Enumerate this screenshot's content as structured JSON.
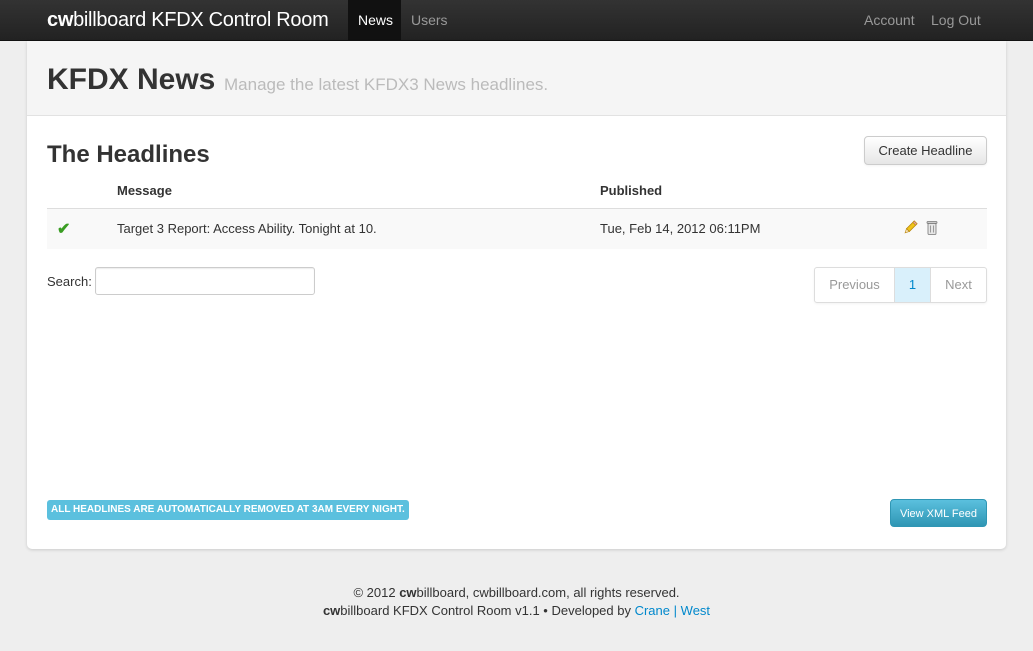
{
  "navbar": {
    "brand_bold": "cw",
    "brand_rest": "billboard KFDX Control Room",
    "items": [
      {
        "label": "News",
        "active": true
      },
      {
        "label": "Users",
        "active": false
      }
    ],
    "account_label": "Account",
    "logout_label": "Log Out"
  },
  "hero": {
    "title": "KFDX News",
    "subtitle": "Manage the latest KFDX3 News headlines."
  },
  "headlines": {
    "title": "The Headlines",
    "create_button": "Create Headline",
    "columns": [
      "Message",
      "Published"
    ],
    "rows": [
      {
        "status_icon": "check-icon",
        "message": "Target 3 Report: Access Ability. Tonight at 10.",
        "published": "Tue, Feb 14, 2012 06:11PM",
        "actions": [
          "edit-pencil-icon",
          "delete-trash-icon"
        ]
      }
    ]
  },
  "search": {
    "label": "Search:",
    "value": "",
    "placeholder": ""
  },
  "pagination": {
    "previous": "Previous",
    "current": "1",
    "next": "Next"
  },
  "notice": "All headlines are automatically removed at 3am every night.",
  "xml_button": "View XML Feed",
  "footer": {
    "line1_prefix": "© 2012 ",
    "line1_brand_bold": "cw",
    "line1_rest": "billboard, cwbillboard.com, all rights reserved.",
    "line2_brand_bold": "cw",
    "line2_rest": "billboard KFDX Control Room v1.1 • Developed by ",
    "link1": "Crane",
    "separator": "|",
    "link2": "West"
  },
  "colors": {
    "navbar": "#222222",
    "accent_info": "#5bc0de",
    "link": "#0088cc",
    "check": "#3a9d23"
  }
}
